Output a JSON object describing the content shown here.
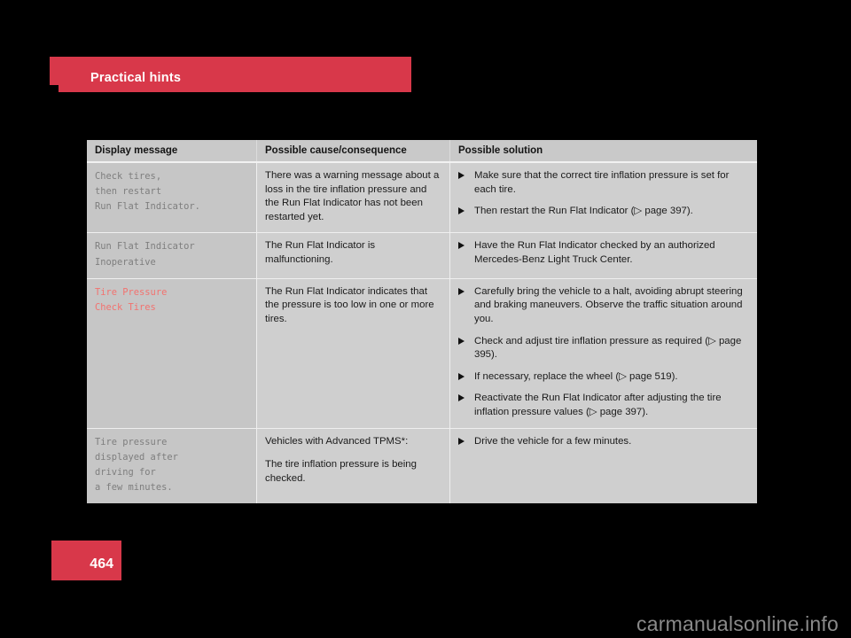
{
  "chapter": {
    "title": "Practical hints"
  },
  "page_number": "464",
  "watermark": "carmanualsonline.info",
  "table": {
    "headers": [
      "Display message",
      "Possible cause/consequence",
      "Possible solution"
    ],
    "rows": [
      {
        "message": "Check tires,\nthen restart\nRun Flat Indicator.",
        "message_style": "normal",
        "cause": [
          "There was a warning message about a loss in the tire inflation pressure and the Run Flat Indicator has not been restarted yet."
        ],
        "solutions": [
          "Make sure that the correct tire inflation pressure is set for each tire.",
          "Then restart the Run Flat Indicator (▷ page 397)."
        ]
      },
      {
        "message": "Run Flat Indicator\nInoperative",
        "message_style": "normal",
        "cause": [
          "The Run Flat Indicator is malfunctioning."
        ],
        "solutions": [
          "Have the Run Flat Indicator checked by an authorized Mercedes-Benz Light Truck Center."
        ]
      },
      {
        "message": "Tire Pressure\nCheck Tires",
        "message_style": "alert",
        "cause": [
          "The Run Flat Indicator indicates that the pressure is too low in one or more tires."
        ],
        "solutions": [
          "Carefully bring the vehicle to a halt, avoiding abrupt steering and braking maneuvers. Observe the traffic situation around you.",
          "Check and adjust tire inflation pressure as required (▷ page 395).",
          "If necessary, replace the wheel (▷ page 519).",
          "Reactivate the Run Flat Indicator after adjusting the tire inflation pressure values (▷ page 397)."
        ]
      },
      {
        "message": "Tire pressure\ndisplayed after\ndriving for\na few minutes.",
        "message_style": "normal",
        "cause": [
          "Vehicles with Advanced TPMS*:",
          "The tire inflation pressure is being checked."
        ],
        "solutions": [
          "Drive the vehicle for a few minutes."
        ]
      }
    ]
  },
  "colors": {
    "accent_red": "#d8384a",
    "alert_text": "#f2726f",
    "table_bg": "#cfcfcf",
    "column1_bg": "#c6c6c6",
    "watermark_gray": "#8a8a8a"
  }
}
